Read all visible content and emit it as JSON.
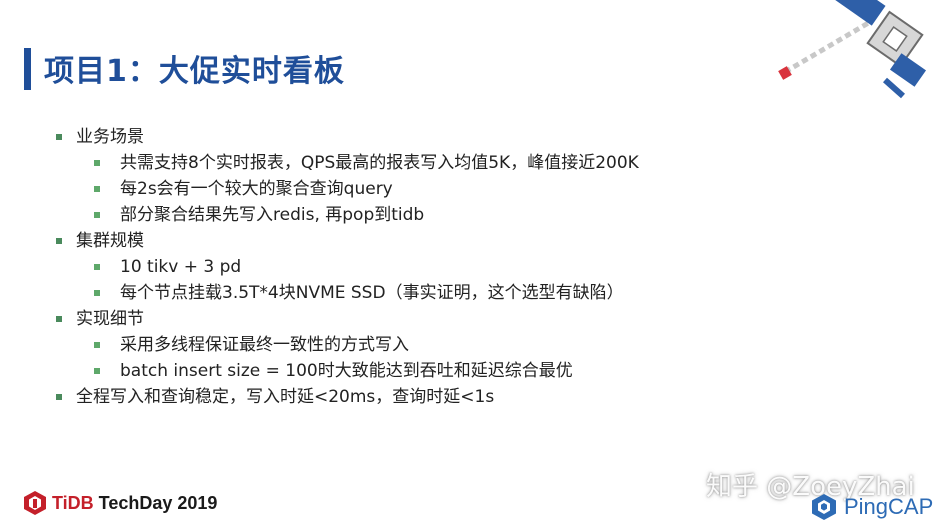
{
  "slide": {
    "title": "项目1：大促实时看板",
    "bullets": [
      {
        "level": 1,
        "text": "业务场景"
      },
      {
        "level": 2,
        "text": "共需支持8个实时报表，QPS最高的报表写入均值5K，峰值接近200K"
      },
      {
        "level": 2,
        "text": "每2s会有一个较大的聚合查询query"
      },
      {
        "level": 2,
        "text": "部分聚合结果先写入redis, 再pop到tidb"
      },
      {
        "level": 1,
        "text": "集群规模"
      },
      {
        "level": 2,
        "text": "10 tikv + 3 pd"
      },
      {
        "level": 2,
        "text": "每个节点挂载3.5T*4块NVME SSD（事实证明，这个选型有缺陷）"
      },
      {
        "level": 1,
        "text": "实现细节"
      },
      {
        "level": 2,
        "text": "采用多线程保证最终一致性的方式写入"
      },
      {
        "level": 2,
        "text": "batch insert size = 100时大致能达到吞吐和延迟综合最优"
      },
      {
        "level": 1,
        "text": "全程写入和查询稳定，写入时延<20ms，查询时延<1s"
      }
    ]
  },
  "footer": {
    "event_brand": "TiDB",
    "event_name": " TechDay 2019",
    "company": "PingCAP",
    "watermark": "知乎 @ZoeyZhai"
  },
  "colors": {
    "title": "#1f4e99",
    "bullet_l1": "#4a8a5c",
    "bullet_l2": "#5ea86a",
    "tidb_red": "#c4202a",
    "pingcap_blue": "#2d6bb5"
  },
  "icons": {
    "decoration": "satellite-icon",
    "event_logo": "tidb-logo-icon",
    "company_logo": "pingcap-logo-icon"
  }
}
